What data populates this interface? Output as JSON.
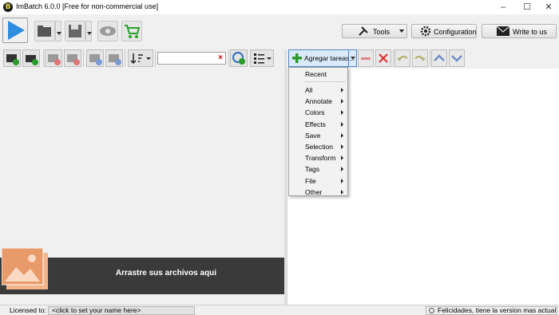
{
  "app": {
    "title": "ImBatch 6.0.0 [Free for non-commercial use]",
    "logo_letter": "B"
  },
  "window_controls": {
    "minimize": "–",
    "maximize": "☐",
    "close": "✕"
  },
  "toolbar": {
    "tools_label": "Tools",
    "configuration_label": "Configuration",
    "write_label": "Write to us"
  },
  "filter": {
    "value": "",
    "clear": "×"
  },
  "tasks": {
    "add_label": "Agregar tareas..."
  },
  "menu": {
    "recent": "Recent",
    "items": [
      "All",
      "Annotate",
      "Colors",
      "Effects",
      "Save",
      "Selection",
      "Transform",
      "Tags",
      "File",
      "Other"
    ]
  },
  "dropzone": {
    "text": "Arrastre sus archivos aqui"
  },
  "status": {
    "licensed_label": "Licensed to:",
    "licensed_value": "<click to set your name here>",
    "message": "Felicidades, tiene la version mas actual"
  },
  "colors": {
    "play": "#2f8de0",
    "cart": "#2aa02a",
    "add_plus": "#2a9a2a",
    "remove": "#d33",
    "dropzone_bg": "#3a3a3a",
    "photo": "#e89a6a"
  },
  "icons": [
    "play-icon",
    "open-folder-icon",
    "save-icon",
    "preview-eye-icon",
    "cart-icon",
    "tools-icon",
    "gear-icon",
    "envelope-icon"
  ]
}
